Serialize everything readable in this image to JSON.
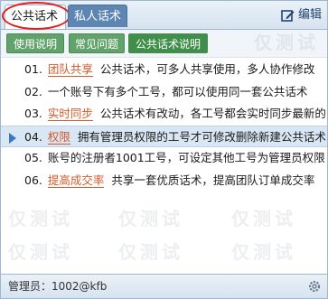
{
  "tabs": [
    {
      "label": "公共话术"
    },
    {
      "label": "私人话术"
    }
  ],
  "edit_label": "编辑",
  "categories": [
    {
      "label": "使用说明"
    },
    {
      "label": "常见问题"
    },
    {
      "label": "公共话术说明"
    }
  ],
  "items": [
    {
      "num": "01.",
      "keyword": "团队共享",
      "text": "公共话术，可多人共享使用，多人协作修改"
    },
    {
      "num": "02.",
      "keyword": "",
      "text": "一个账号下有多个工号，都可以使用同一套公共话术"
    },
    {
      "num": "03.",
      "keyword": "实时同步",
      "text": "公共话术有改动，各工号都会实时同步最新的"
    },
    {
      "num": "04.",
      "keyword": "权限",
      "text": "拥有管理员权限的工号才可修改删除新建公共话术"
    },
    {
      "num": "05.",
      "keyword": "",
      "text": "账号的注册者1001工号，可设定其他工号为管理员权限"
    },
    {
      "num": "06.",
      "keyword": "提高成交率",
      "text": "共享一套优质话术，提高团队订单成交率"
    }
  ],
  "watermark": "仅测试",
  "footer": {
    "user": "管理员：1002@kfb"
  },
  "colors": {
    "accent_red": "#e02020",
    "category_green": "#62a36b",
    "keyword_orange": "#d35a2a",
    "selection_blue": "#d9e6f4"
  },
  "icons": {
    "edit": "edit-icon",
    "selected_arrow": "triangle-right-icon",
    "settings": "gear-icon"
  }
}
